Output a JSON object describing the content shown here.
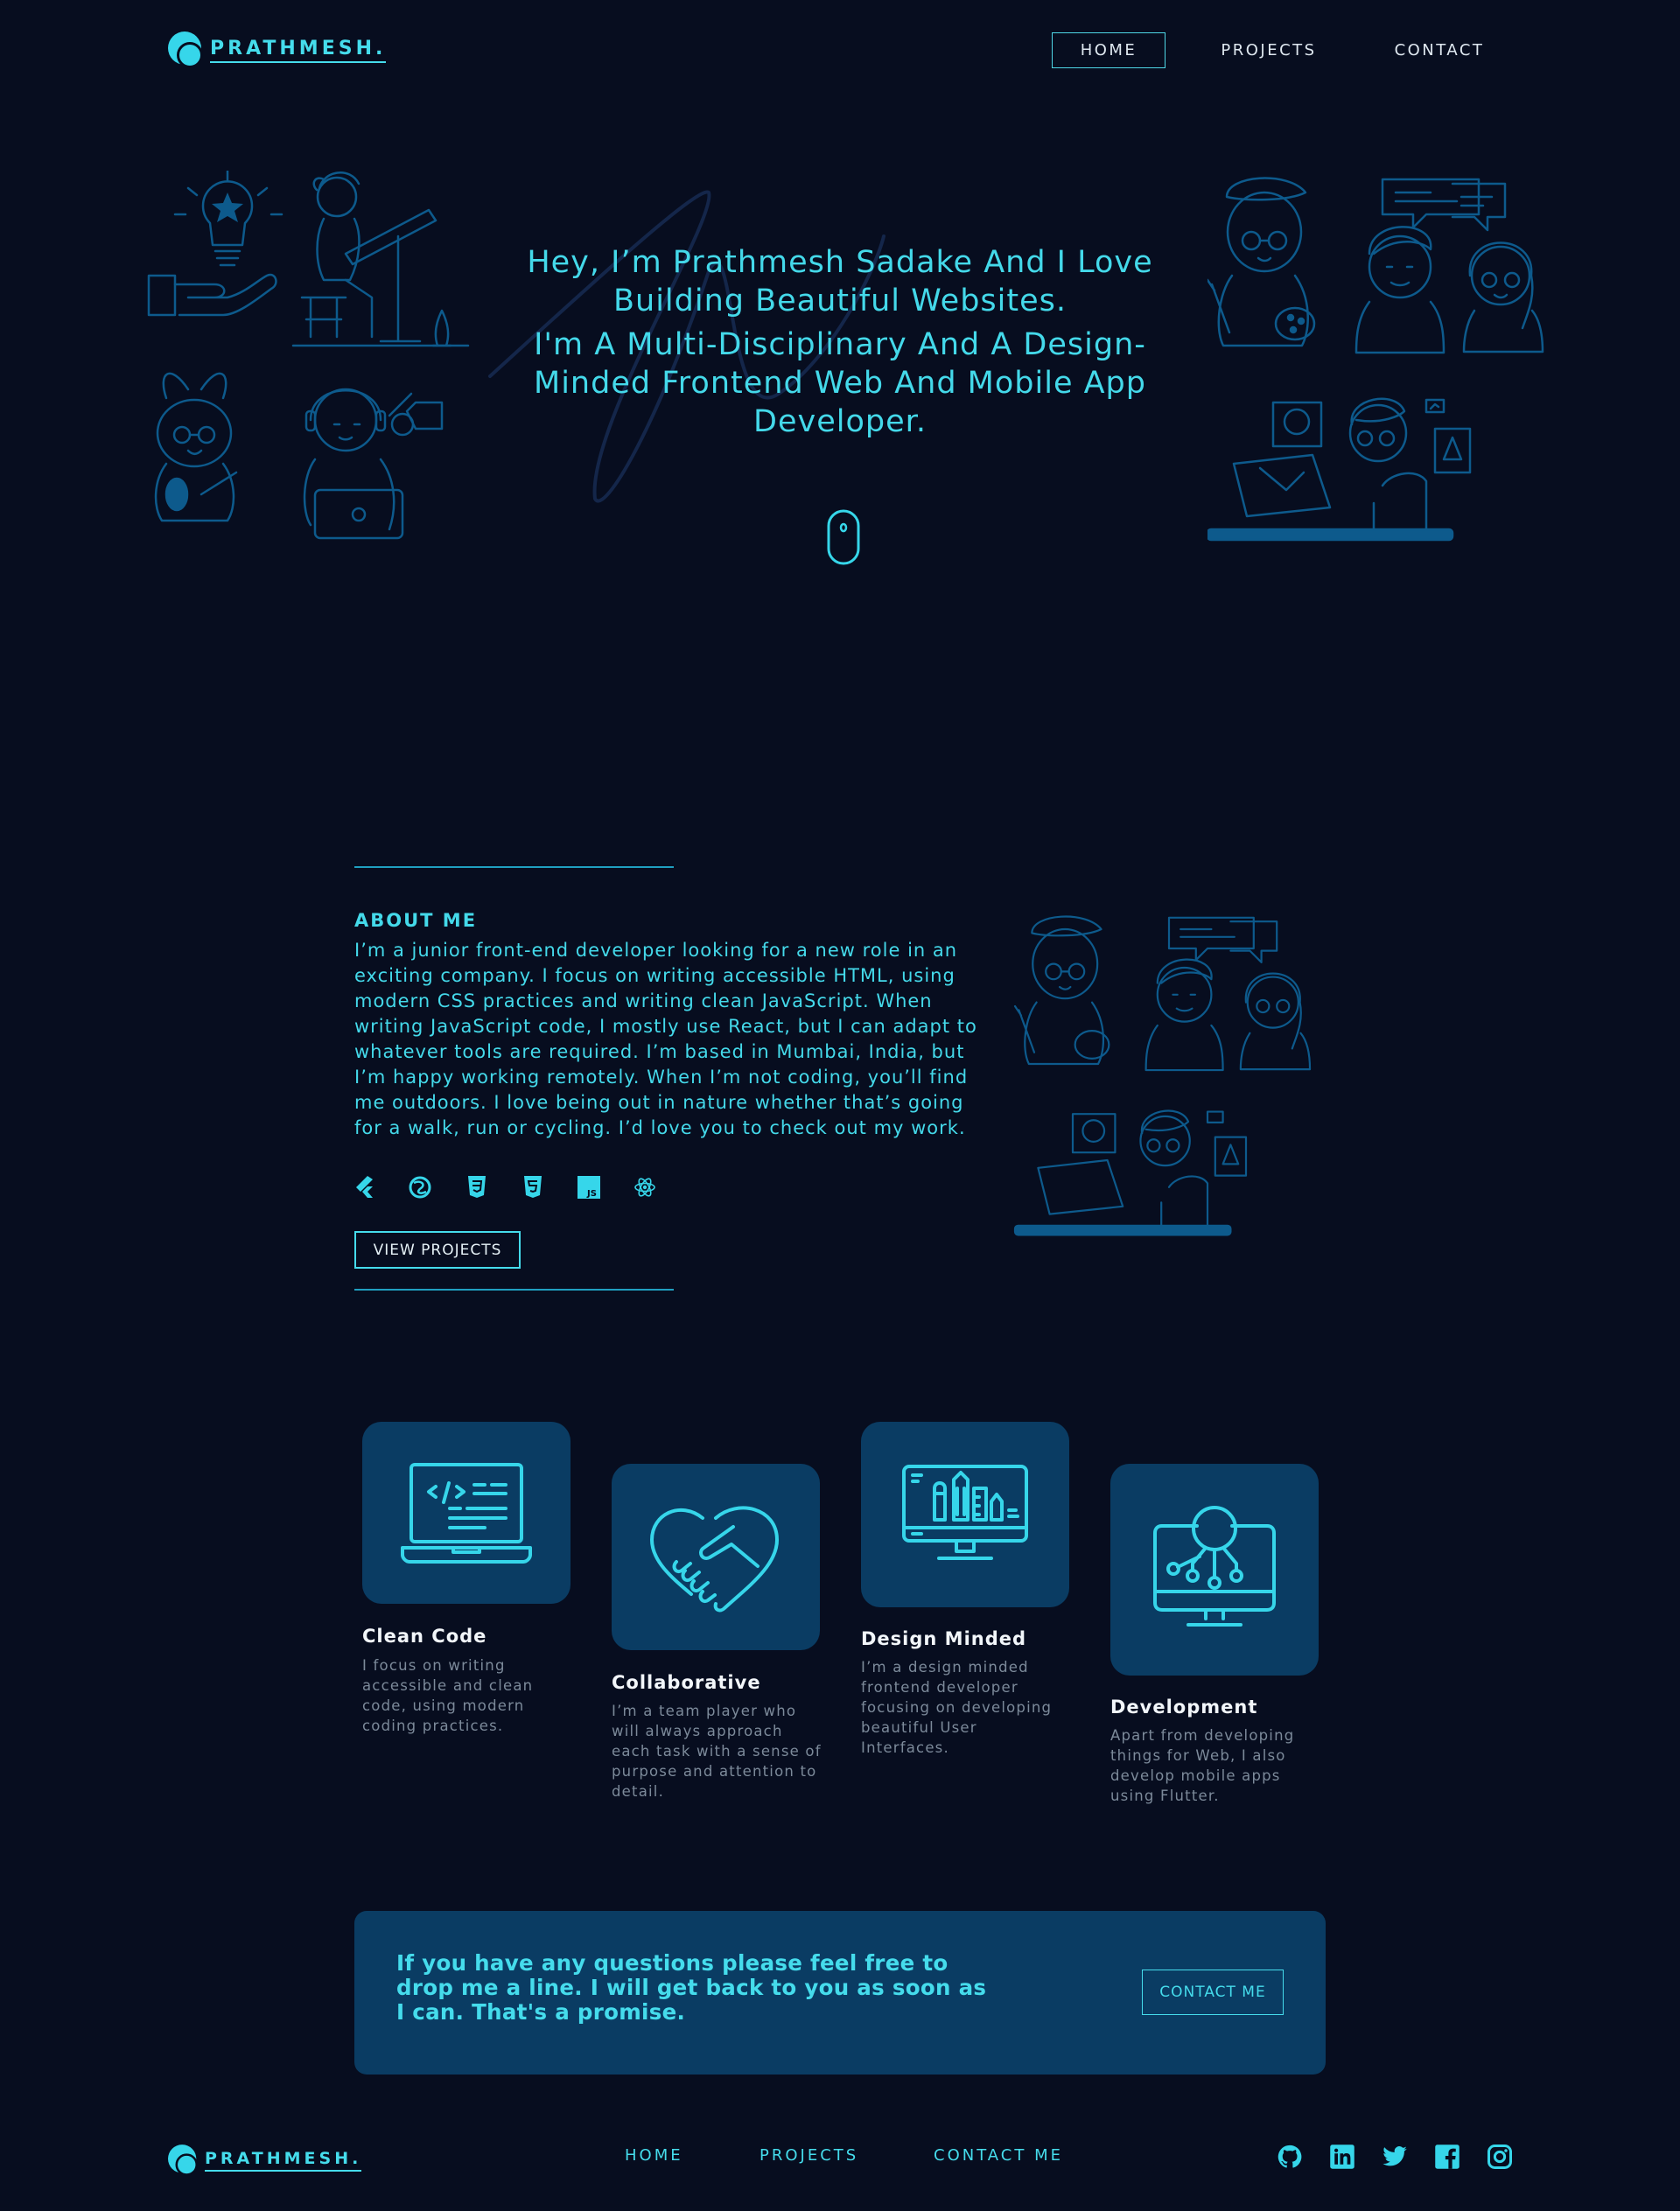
{
  "header": {
    "logo_text": "PRATHMESH.",
    "nav": [
      {
        "label": "HOME",
        "active": true
      },
      {
        "label": "PROJECTS",
        "active": false
      },
      {
        "label": "CONTACT",
        "active": false
      }
    ]
  },
  "hero": {
    "line1": "Hey, I’m Prathmesh Sadake And I Love Building Beautiful Websites.",
    "line2": "I'm A Multi-Disciplinary And A Design-Minded Frontend Web And Mobile App Developer."
  },
  "about": {
    "title": "ABOUT ME",
    "body": "I’m a junior front-end developer looking for a new role in an exciting company. I focus on writing accessible HTML, using modern CSS practices and writing clean JavaScript. When writing JavaScript code, I mostly use React, but I can adapt to whatever tools are required. I’m based in Mumbai, India, but I’m happy working remotely. When I’m not coding, you’ll find me outdoors. I love being out in nature whether that’s going for a walk, run or cycling. I’d love you to check out my work.",
    "tech_icons": [
      "flutter-icon",
      "sass-icon",
      "css3-icon",
      "html5-icon",
      "javascript-icon",
      "react-icon"
    ],
    "cta_label": "VIEW PROJECTS"
  },
  "cards": [
    {
      "title": "Clean Code",
      "desc": "I focus on writing accessible and clean code, using modern coding practices.",
      "icon": "laptop-code-icon"
    },
    {
      "title": "Collaborative",
      "desc": "I’m a team player who will always approach each task with a sense of purpose and attention to detail.",
      "icon": "handshake-heart-icon"
    },
    {
      "title": "Design Minded",
      "desc": "I’m a design minded frontend developer focusing on developing beautiful User Interfaces.",
      "icon": "design-monitor-icon"
    },
    {
      "title": "Development",
      "desc": "Apart from developing things for Web, I also develop mobile apps using Flutter.",
      "icon": "development-monitor-icon"
    }
  ],
  "cta": {
    "text": "If you have any questions please feel free to drop me a line. I will get back to you as soon as I can. That's a promise.",
    "button": "CONTACT ME"
  },
  "footer": {
    "logo_text": "PRATHMESH.",
    "links": [
      "HOME",
      "PROJECTS",
      "CONTACT ME"
    ],
    "social": [
      "github-icon",
      "linkedin-icon",
      "twitter-icon",
      "facebook-icon",
      "instagram-icon"
    ]
  },
  "colors": {
    "background": "#070d1f",
    "accent": "#44d9ea",
    "card": "#0a3c63",
    "illustration": "#0d5a8c"
  }
}
